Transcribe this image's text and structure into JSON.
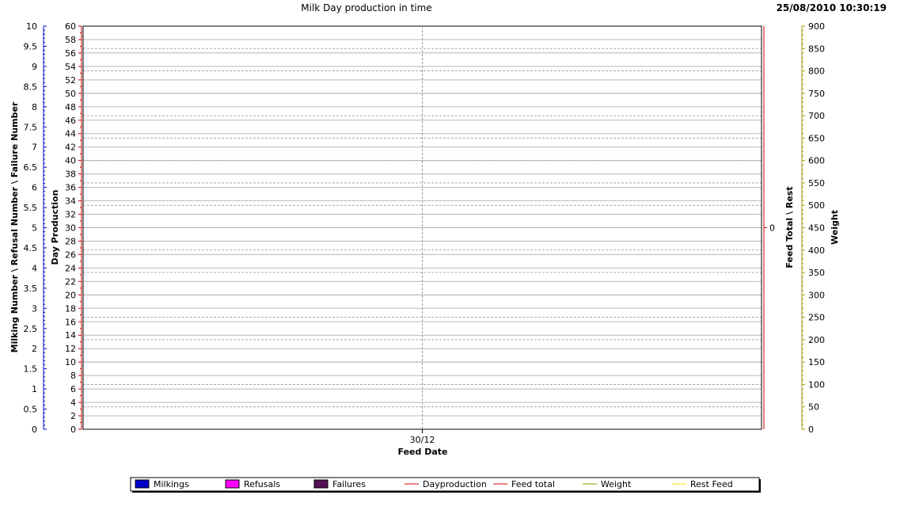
{
  "chart_data": {
    "type": "line",
    "title": "Milk Day production in time",
    "timestamp": "25/08/2010 10:30:19",
    "xlabel": "Feed Date",
    "categories": [
      "30/12"
    ],
    "axes": {
      "milkings": {
        "label": "Milking Number \\ Refusal Number \\ Failure Number",
        "range": [
          0,
          10
        ],
        "ticks": [
          "0",
          "0.5",
          "1",
          "1.5",
          "2",
          "2.5",
          "3",
          "3.5",
          "4",
          "4.5",
          "5",
          "5.5",
          "6",
          "6.5",
          "7",
          "7.5",
          "8",
          "8.5",
          "9",
          "9.5",
          "10"
        ],
        "color": "#0000cc"
      },
      "day_production": {
        "label": "Day Production",
        "range": [
          0,
          60
        ],
        "ticks": [
          "0",
          "2",
          "4",
          "6",
          "8",
          "10",
          "12",
          "14",
          "16",
          "18",
          "20",
          "22",
          "24",
          "26",
          "28",
          "30",
          "32",
          "34",
          "36",
          "38",
          "40",
          "42",
          "44",
          "46",
          "48",
          "50",
          "52",
          "54",
          "56",
          "58",
          "60"
        ],
        "color": "#cc0000"
      },
      "feed_total": {
        "label": "Feed Total \\ Rest",
        "ticks": [
          "0"
        ],
        "color": "#cc0000"
      },
      "weight": {
        "label": "Weight",
        "range": [
          0,
          900
        ],
        "ticks": [
          "0",
          "50",
          "100",
          "150",
          "200",
          "250",
          "300",
          "350",
          "400",
          "450",
          "500",
          "550",
          "600",
          "650",
          "700",
          "750",
          "800",
          "850",
          "900"
        ],
        "color": "#999900"
      }
    },
    "grid": true,
    "legend_placement": "bottom",
    "series": [
      {
        "name": "Milkings",
        "kind": "bar",
        "color": "#0000cc",
        "values": []
      },
      {
        "name": "Refusals",
        "kind": "bar",
        "color": "#ff00ff",
        "values": []
      },
      {
        "name": "Failures",
        "kind": "bar",
        "color": "#551155",
        "values": []
      },
      {
        "name": "Dayproduction",
        "kind": "line",
        "color": "#cc0000",
        "values": []
      },
      {
        "name": "Feed total",
        "kind": "line",
        "color": "#cc0000",
        "values": []
      },
      {
        "name": "Weight",
        "kind": "line",
        "color": "#999900",
        "values": []
      },
      {
        "name": "Rest Feed",
        "kind": "line",
        "color": "#e8e800",
        "values": []
      }
    ]
  }
}
